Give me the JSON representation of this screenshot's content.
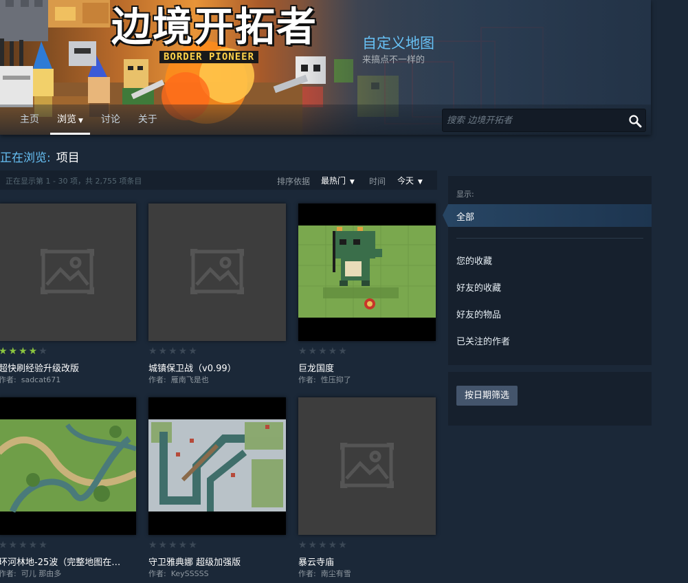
{
  "header": {
    "logo_cn": "边境开拓者",
    "logo_en": "BORDER PIONEER",
    "title": "自定义地图",
    "subtitle": "来搞点不一样的",
    "nav": [
      {
        "label": "主页"
      },
      {
        "label": "浏览"
      },
      {
        "label": "讨论"
      },
      {
        "label": "关于"
      }
    ],
    "search_placeholder": "搜索 边境开拓者"
  },
  "browsing": {
    "label": "正在浏览:",
    "value": "项目"
  },
  "sortbar": {
    "count_text": "正在显示第 1 - 30 项，共 2,755 项条目",
    "sort_label": "排序依据",
    "sort_value": "最热门",
    "time_label": "时间",
    "time_value": "今天"
  },
  "items": [
    {
      "title": "超快刷经验升级改版",
      "author_label": "作者:",
      "author": "sadcat671",
      "stars": 4
    },
    {
      "title": "城镇保卫战（v0.99）",
      "author_label": "作者:",
      "author": "雁南飞是也",
      "stars": 0
    },
    {
      "title": "巨龙国度",
      "author_label": "作者:",
      "author": "性压抑了",
      "stars": 0
    },
    {
      "title": "环河林地-25波（完整地图在…",
      "author_label": "作者:",
      "author": "可儿 那由多",
      "stars": 0
    },
    {
      "title": "守卫雅典娜 超级加强版",
      "author_label": "作者:",
      "author": "KeySSSSS",
      "stars": 0
    },
    {
      "title": "暴云寺庙",
      "author_label": "作者:",
      "author": "南尘有雪",
      "stars": 0
    }
  ],
  "filter": {
    "show_label": "显示:",
    "active": "全部",
    "options": [
      "您的收藏",
      "好友的收藏",
      "好友的物品",
      "已关注的作者"
    ],
    "date_button": "按日期筛选"
  },
  "colors": {
    "background": "#1b2838",
    "accent_blue": "#67c1f5",
    "star_on": "#8bc53f",
    "star_off": "#3b4856"
  }
}
